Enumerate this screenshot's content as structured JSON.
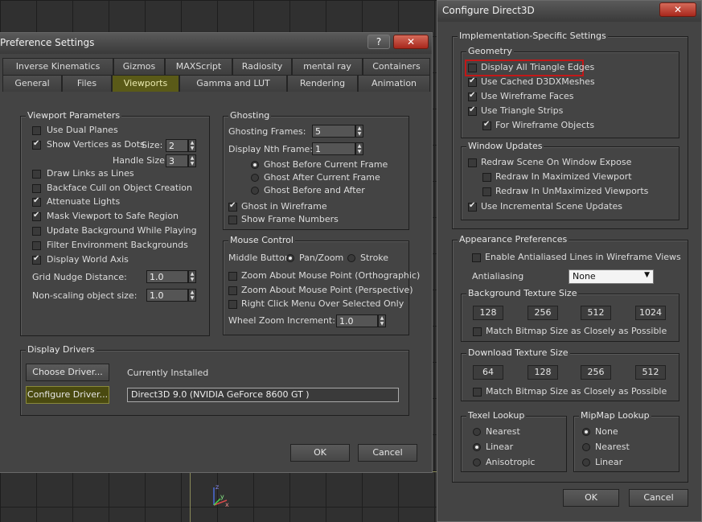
{
  "pref": {
    "title": "Preference Settings",
    "help": "?",
    "close": "✕",
    "tabs_row1": [
      "Inverse Kinematics",
      "Gizmos",
      "MAXScript",
      "Radiosity",
      "mental ray",
      "Containers"
    ],
    "tabs_row2": [
      "General",
      "Files",
      "Viewports",
      "Gamma and LUT",
      "Rendering",
      "Animation"
    ],
    "viewport_params": {
      "title": "Viewport Parameters",
      "use_dual_planes": "Use Dual Planes",
      "show_vertices": "Show Vertices as Dots",
      "size_label": "Size:",
      "size_value": "2",
      "handle_label": "Handle Size:",
      "handle_value": "3",
      "draw_links": "Draw Links as Lines",
      "backface_cull": "Backface Cull on Object Creation",
      "attenuate": "Attenuate Lights",
      "mask_viewport": "Mask Viewport to Safe Region",
      "update_bg": "Update Background While Playing",
      "filter_env": "Filter Environment Backgrounds",
      "display_world": "Display World Axis",
      "grid_nudge": "Grid Nudge Distance:",
      "grid_nudge_value": "1.0",
      "nonscaling": "Non-scaling object size:",
      "nonscaling_value": "1.0"
    },
    "ghosting": {
      "title": "Ghosting",
      "frames_label": "Ghosting Frames:",
      "frames_value": "5",
      "nth_label": "Display Nth Frame:",
      "nth_value": "1",
      "before": "Ghost Before Current Frame",
      "after": "Ghost After Current Frame",
      "both": "Ghost Before and After",
      "wireframe": "Ghost in Wireframe",
      "frame_numbers": "Show Frame Numbers"
    },
    "mouse": {
      "title": "Mouse Control",
      "middle_label": "Middle Button:",
      "panzoom": "Pan/Zoom",
      "stroke": "Stroke",
      "zoom_ortho": "Zoom About Mouse Point (Orthographic)",
      "zoom_persp": "Zoom About Mouse Point (Perspective)",
      "right_click": "Right Click Menu Over Selected Only",
      "wheel_label": "Wheel Zoom Increment:",
      "wheel_value": "1.0"
    },
    "drivers": {
      "title": "Display Drivers",
      "choose": "Choose Driver...",
      "installed": "Currently Installed",
      "configure": "Configure Driver...",
      "driver_value": "Direct3D 9.0 (NVIDIA GeForce 8600 GT )"
    },
    "ok": "OK",
    "cancel": "Cancel"
  },
  "d3d": {
    "title": "Configure Direct3D",
    "minimize": "_",
    "close": "✕",
    "impl_title": "Implementation-Specific Settings",
    "geometry": {
      "title": "Geometry",
      "all_edges": "Display All Triangle Edges",
      "cached": "Use Cached D3DXMeshes",
      "wire_faces": "Use Wireframe Faces",
      "strips": "Use Triangle Strips",
      "for_wire": "For Wireframe Objects"
    },
    "window_updates": {
      "title": "Window Updates",
      "redraw": "Redraw Scene On Window Expose",
      "maximized": "Redraw In Maximized Viewport",
      "unmaximized": "Redraw In UnMaximized Viewports",
      "incremental": "Use Incremental Scene Updates"
    },
    "appearance": {
      "title": "Appearance Preferences",
      "antialiased": "Enable Antialiased Lines in Wireframe Views",
      "antialiasing_label": "Antialiasing",
      "antialiasing_value": "None",
      "bg_title": "Background Texture Size",
      "bg_sizes": [
        "128",
        "256",
        "512",
        "1024"
      ],
      "bg_match": "Match Bitmap Size as Closely as Possible",
      "dl_title": "Download Texture Size",
      "dl_sizes": [
        "64",
        "128",
        "256",
        "512"
      ],
      "dl_match": "Match Bitmap Size as Closely as Possible",
      "texel_title": "Texel Lookup",
      "texel": [
        "Nearest",
        "Linear",
        "Anisotropic"
      ],
      "mip_title": "MipMap Lookup",
      "mip": [
        "None",
        "Nearest",
        "Linear"
      ]
    },
    "ok": "OK",
    "cancel": "Cancel"
  },
  "axis": {
    "x": "x",
    "y": "y",
    "z": "z"
  }
}
